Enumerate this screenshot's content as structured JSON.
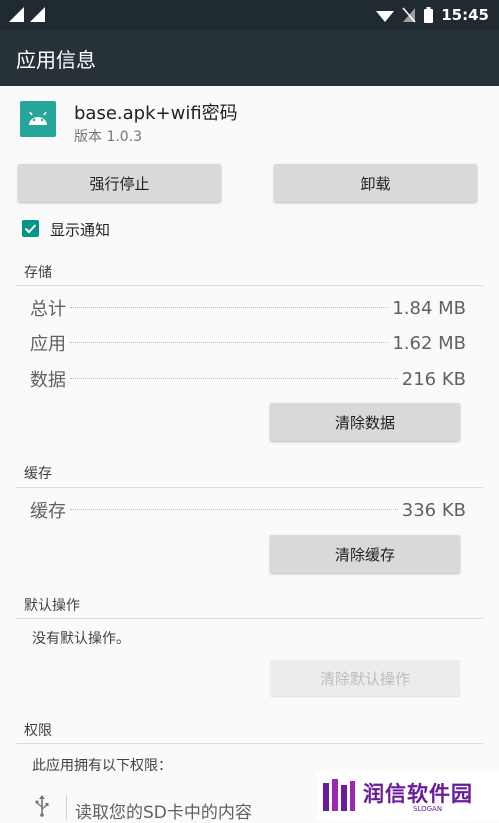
{
  "status_bar": {
    "time": "15:45",
    "icons": [
      "signal-icon",
      "signal-icon",
      "wifi-icon",
      "no-sim-icon",
      "battery-icon"
    ]
  },
  "app_bar": {
    "title": "应用信息"
  },
  "app": {
    "name": "base.apk+wifi密码",
    "version": "版本 1.0.3",
    "icon": "android-icon"
  },
  "buttons": {
    "force_stop": "强行停止",
    "uninstall": "卸载"
  },
  "notification": {
    "label": "显示通知",
    "checked": true
  },
  "storage": {
    "header": "存储",
    "rows": [
      {
        "label": "总计",
        "value": "1.84 MB"
      },
      {
        "label": "应用",
        "value": "1.62 MB"
      },
      {
        "label": "数据",
        "value": "216 KB"
      }
    ],
    "clear_button": "清除数据"
  },
  "cache": {
    "header": "缓存",
    "rows": [
      {
        "label": "缓存",
        "value": "336 KB"
      }
    ],
    "clear_button": "清除缓存"
  },
  "defaults": {
    "header": "默认操作",
    "text": "没有默认操作。",
    "clear_button": "清除默认操作"
  },
  "permissions": {
    "header": "权限",
    "text": "此应用拥有以下权限：",
    "items": [
      {
        "icon": "usb-icon",
        "label": "读取您的SD卡中的内容"
      }
    ]
  },
  "watermark": {
    "name": "润信软件园",
    "slogan": "SLOGAN"
  },
  "colors": {
    "accent": "#009688",
    "app_icon_bg": "#26a69a",
    "toolbar": "#263238",
    "watermark": "#6a1b9a"
  }
}
